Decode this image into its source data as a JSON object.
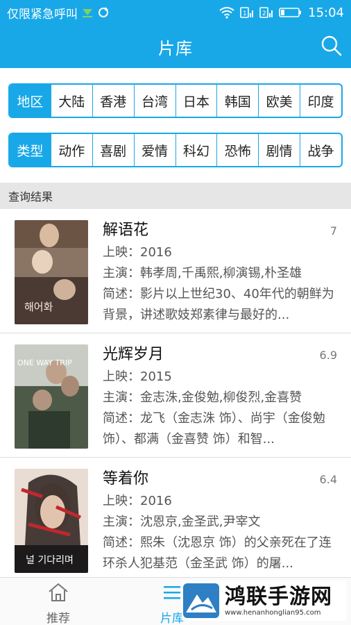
{
  "status_bar": {
    "carrier": "仅限紧急呼叫",
    "time": "15:04"
  },
  "app_bar": {
    "title": "片库"
  },
  "filters": {
    "region": {
      "label": "地区",
      "options": [
        "大陆",
        "香港",
        "台湾",
        "日本",
        "韩国",
        "欧美",
        "印度"
      ]
    },
    "genre": {
      "label": "类型",
      "options": [
        "动作",
        "喜剧",
        "爱情",
        "科幻",
        "恐怖",
        "剧情",
        "战争"
      ]
    }
  },
  "results": {
    "header": "查询结果",
    "items": [
      {
        "title": "解语花",
        "score": "7",
        "release": "上映：2016",
        "cast": "主演：韩孝周,千禹熙,柳演锡,朴圣雄",
        "desc": "简述：影片以上世纪30、40年代的朝鲜为背景，讲述歌妓郑素律与最好的...",
        "poster_text": "해어화"
      },
      {
        "title": "光辉岁月",
        "score": "6.9",
        "release": "上映：2015",
        "cast": "主演：金志洙,金俊勉,柳俊烈,金喜赞",
        "desc": "简述：龙飞（金志洙 饰）、尚宇（金俊勉 饰）、都满（金喜赞 饰）和智...",
        "poster_text": "ONE WAY TRIP"
      },
      {
        "title": "等着你",
        "score": "6.4",
        "release": "上映：2016",
        "cast": "主演：沈恩京,金圣武,尹宰文",
        "desc": "简述：熙朱（沈恩京 饰）的父亲死在了连环杀人犯基范（金圣武 饰）的屠...",
        "poster_text": "널 기다리며"
      }
    ]
  },
  "tab_bar": {
    "tabs": [
      {
        "label": "推荐",
        "icon": "home-icon"
      },
      {
        "label": "片库",
        "icon": "menu-icon"
      }
    ]
  },
  "watermark": {
    "name": "鸿联手游网",
    "url": "www.henanhonglian95.com"
  },
  "colors": {
    "accent": "#18a8e8",
    "section_bg": "#e6e6e6"
  }
}
